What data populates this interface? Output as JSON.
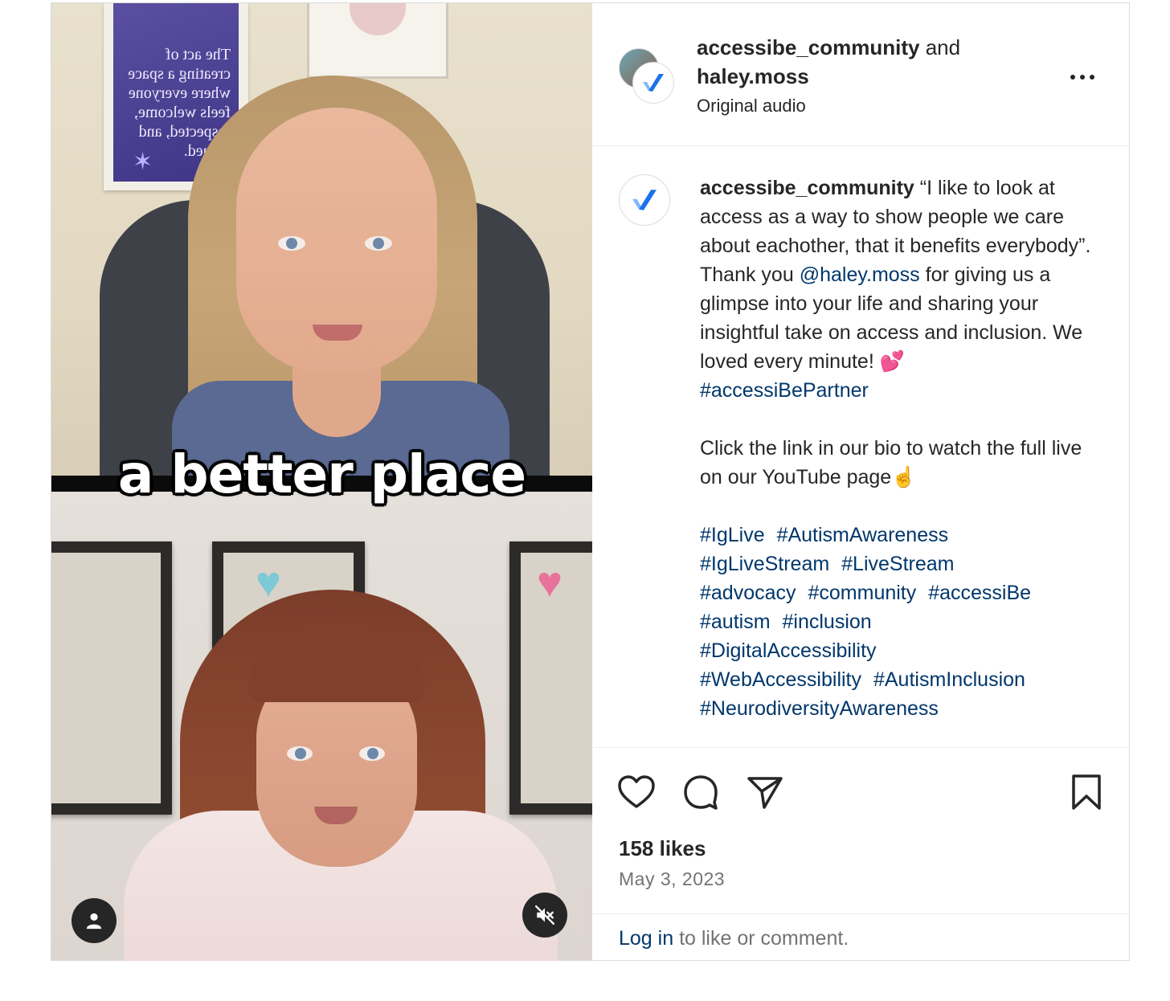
{
  "video": {
    "overlay_caption": "a better place",
    "poster_text": "The act of creating a space where everyone feels welcome, respected, and valued."
  },
  "header": {
    "account_1": "accessibe_community",
    "and_text": "and",
    "account_2": "haley.moss",
    "audio": "Original audio"
  },
  "caption": {
    "username": "accessibe_community",
    "part_1": "“I like to look at access as a way to show people we care about eachother, that it benefits everybody”. Thank you",
    "mention": "@haley.moss",
    "part_2": "for giving us a glimpse into your life and sharing your insightful take on access and inclusion. We loved every minute! 💕",
    "partner_tag": "#accessiBePartner",
    "part_3": "Click the link in our bio to watch the full live on our YouTube page☝️",
    "hashtags": [
      "#IgLive",
      "#AutismAwareness",
      "#IgLiveStream",
      "#LiveStream",
      "#advocacy",
      "#community",
      "#accessiBe",
      "#autism",
      "#inclusion",
      "#DigitalAccessibility",
      "#WebAccessibility",
      "#AutismInclusion",
      "#NeurodiversityAwareness"
    ]
  },
  "stats": {
    "likes": "158 likes",
    "date": "May 3, 2023"
  },
  "login": {
    "link": "Log in",
    "rest": "to like or comment."
  },
  "colors": {
    "link": "#00376b",
    "secondary_text": "#737373",
    "brand_blue": "#1a73e8"
  }
}
